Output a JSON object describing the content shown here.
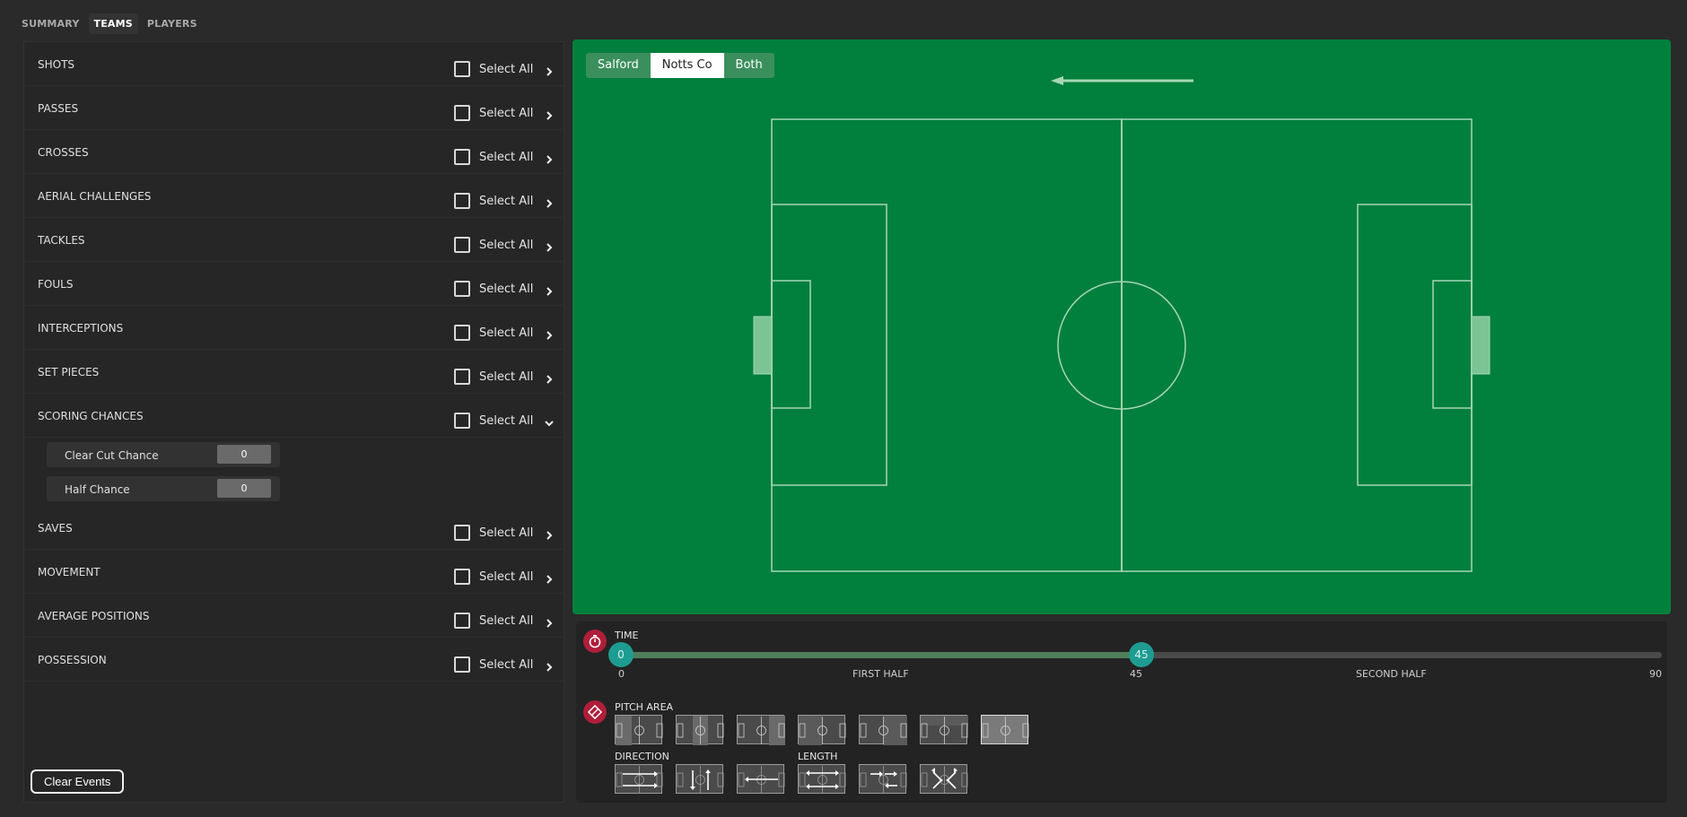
{
  "tabs": [
    "SUMMARY",
    "TEAMS",
    "PLAYERS"
  ],
  "categories": [
    {
      "name": "SHOTS",
      "select": "Select All"
    },
    {
      "name": "PASSES",
      "select": "Select All"
    },
    {
      "name": "CROSSES",
      "select": "Select All"
    },
    {
      "name": "AERIAL CHALLENGES",
      "select": "Select All"
    },
    {
      "name": "TACKLES",
      "select": "Select All"
    },
    {
      "name": "FOULS",
      "select": "Select All"
    },
    {
      "name": "INTERCEPTIONS",
      "select": "Select All"
    },
    {
      "name": "SET PIECES",
      "select": "Select All"
    },
    {
      "name": "SCORING CHANCES",
      "select": "Select All"
    },
    {
      "name": "SAVES",
      "select": "Select All"
    },
    {
      "name": "MOVEMENT",
      "select": "Select All"
    },
    {
      "name": "AVERAGE POSITIONS",
      "select": "Select All"
    },
    {
      "name": "POSSESSION",
      "select": "Select All"
    }
  ],
  "scoring_chances": [
    {
      "label": "Clear Cut Chance",
      "value": "0"
    },
    {
      "label": "Half Chance",
      "value": "0"
    }
  ],
  "clear_events": "Clear Events",
  "teams": [
    "Salford",
    "Notts Co",
    "Both"
  ],
  "selected_team": "Notts Co",
  "time": {
    "title": "TIME",
    "start": "0",
    "handle": "45",
    "tick_start": "0",
    "first_half": "FIRST HALF",
    "tick_mid": "45",
    "second_half": "SECOND HALF",
    "tick_end": "90",
    "min": 0,
    "max": 90,
    "range": [
      0,
      45
    ]
  },
  "pitch_area": {
    "title": "PITCH AREA",
    "selected_index": 6
  },
  "direction": {
    "title": "DIRECTION"
  },
  "length": {
    "title": "LENGTH"
  },
  "colors": {
    "pitch": "#007f3d",
    "accent": "#1e9c92",
    "icon": "#b01e3a"
  }
}
